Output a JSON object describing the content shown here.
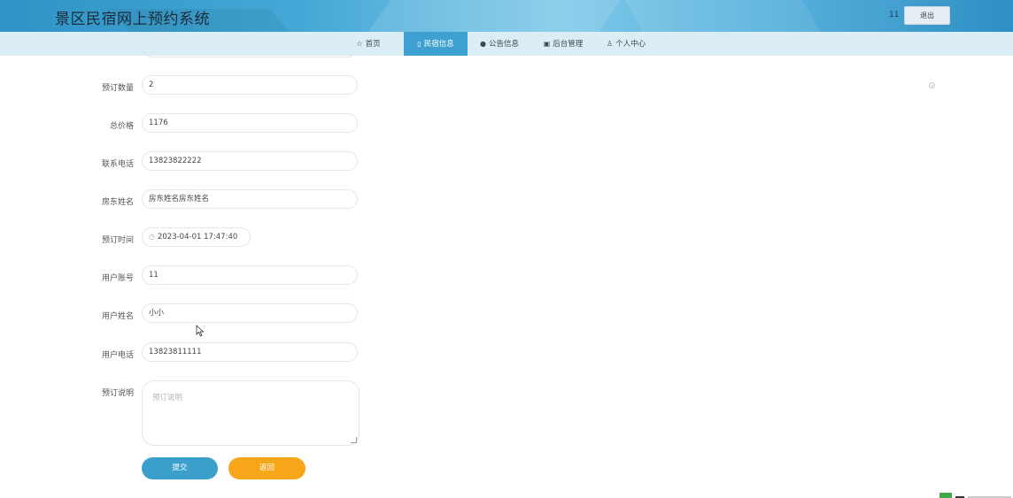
{
  "header": {
    "title": "景区民宿网上预约系统",
    "username": "11",
    "logout_label": "退出"
  },
  "nav": {
    "items": [
      {
        "label": "首页",
        "icon": "star-icon"
      },
      {
        "label": "民宿信息",
        "icon": "clipboard-icon",
        "active": true
      },
      {
        "label": "公告信息",
        "icon": "info-circle-icon"
      },
      {
        "label": "后台管理",
        "icon": "save-icon"
      },
      {
        "label": "个人中心",
        "icon": "user-icon"
      }
    ]
  },
  "form": {
    "quantity": {
      "label": "预订数量",
      "value": "2"
    },
    "total_price": {
      "label": "总价格",
      "value": "1176"
    },
    "contact_phone": {
      "label": "联系电话",
      "value": "13823822222"
    },
    "landlord_name": {
      "label": "房东姓名",
      "value": "房东姓名房东姓名"
    },
    "booking_time": {
      "label": "预订时间",
      "value": "2023-04-01 17:47:40"
    },
    "user_account": {
      "label": "用户账号",
      "value": "11"
    },
    "user_name": {
      "label": "用户姓名",
      "value": "小小"
    },
    "user_phone": {
      "label": "用户电话",
      "value": "13823811111"
    },
    "booking_note": {
      "label": "预订说明",
      "placeholder": "预订说明"
    },
    "submit_label": "提交",
    "back_label": "返回"
  },
  "colors": {
    "header_bg": "#3ea0d0",
    "nav_bg": "#dbeef6",
    "active_nav": "#3ea0d0",
    "submit": "#3b9fcc",
    "back": "#f7a61a"
  }
}
